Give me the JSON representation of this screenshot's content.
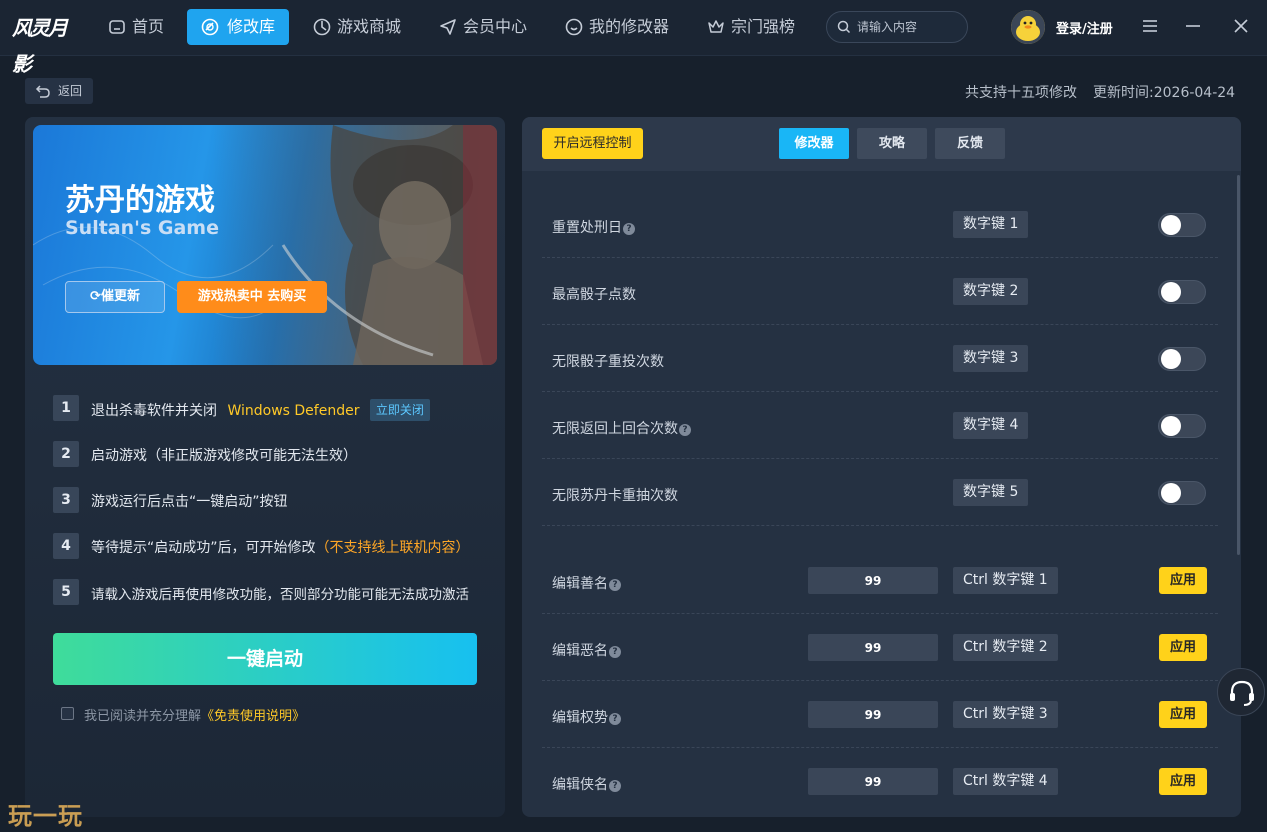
{
  "app": {
    "logo_text": "风灵月影"
  },
  "nav": {
    "items": [
      {
        "label": "首页",
        "icon": "home-icon"
      },
      {
        "label": "修改库",
        "icon": "library-icon",
        "active": true
      },
      {
        "label": "游戏商城",
        "icon": "store-icon"
      },
      {
        "label": "会员中心",
        "icon": "send-icon"
      },
      {
        "label": "我的修改器",
        "icon": "chat-icon"
      },
      {
        "label": "宗门强榜",
        "icon": "crown-icon"
      }
    ],
    "search_placeholder": "请输入内容",
    "login_label": "登录/注册"
  },
  "subbar": {
    "back_label": "返回",
    "support_count": "共支持十五项修改",
    "update_label": "更新时间:",
    "update_date": "2026-04-24"
  },
  "game": {
    "title_cn": "苏丹的游戏",
    "title_en": "Sultan's Game",
    "update_btn": "催更新",
    "buy_btn": "游戏热卖中 去购买"
  },
  "steps": [
    {
      "num": "1",
      "text": "退出杀毒软件并关闭",
      "highlight": "Windows Defender",
      "tag": "立即关闭"
    },
    {
      "num": "2",
      "text": "启动游戏（非正版游戏修改可能无法生效）"
    },
    {
      "num": "3",
      "text": "游戏运行后点击“一键启动”按钮"
    },
    {
      "num": "4",
      "text": "等待提示“启动成功”后，可开始修改",
      "note": "（不支持线上联机内容）"
    },
    {
      "num": "5",
      "text": "请载入游戏后再使用修改功能，否则部分功能可能无法成功激活"
    }
  ],
  "start_btn": "一键启动",
  "agree": {
    "text": "我已阅读并充分理解",
    "link": "《免责使用说明》"
  },
  "watermark": "玩一玩",
  "right": {
    "remote_btn": "开启远程控制",
    "tabs": [
      "修改器",
      "攻略",
      "反馈"
    ],
    "toggles": [
      {
        "name": "重置处刑日",
        "help": true,
        "hotkey": "数字键 1"
      },
      {
        "name": "最高骰子点数",
        "help": false,
        "hotkey": "数字键 2"
      },
      {
        "name": "无限骰子重投次数",
        "help": false,
        "hotkey": "数字键 3"
      },
      {
        "name": "无限返回上回合次数",
        "help": true,
        "hotkey": "数字键 4"
      },
      {
        "name": "无限苏丹卡重抽次数",
        "help": false,
        "hotkey": "数字键 5"
      }
    ],
    "edits": [
      {
        "name": "编辑善名",
        "value": "99",
        "hotkey": "Ctrl  数字键 1"
      },
      {
        "name": "编辑恶名",
        "value": "99",
        "hotkey": "Ctrl  数字键 2"
      },
      {
        "name": "编辑权势",
        "value": "99",
        "hotkey": "Ctrl  数字键 3"
      },
      {
        "name": "编辑侠名",
        "value": "99",
        "hotkey": "Ctrl  数字键 4"
      }
    ],
    "apply_label": "应用",
    "help_glyph": "?"
  },
  "colors": {
    "accent": "#1fa4ef",
    "yellow": "#ffd21a",
    "orange": "#ff8c1a",
    "start_gradient": [
      "#3fdc9a",
      "#17c0f0"
    ]
  }
}
